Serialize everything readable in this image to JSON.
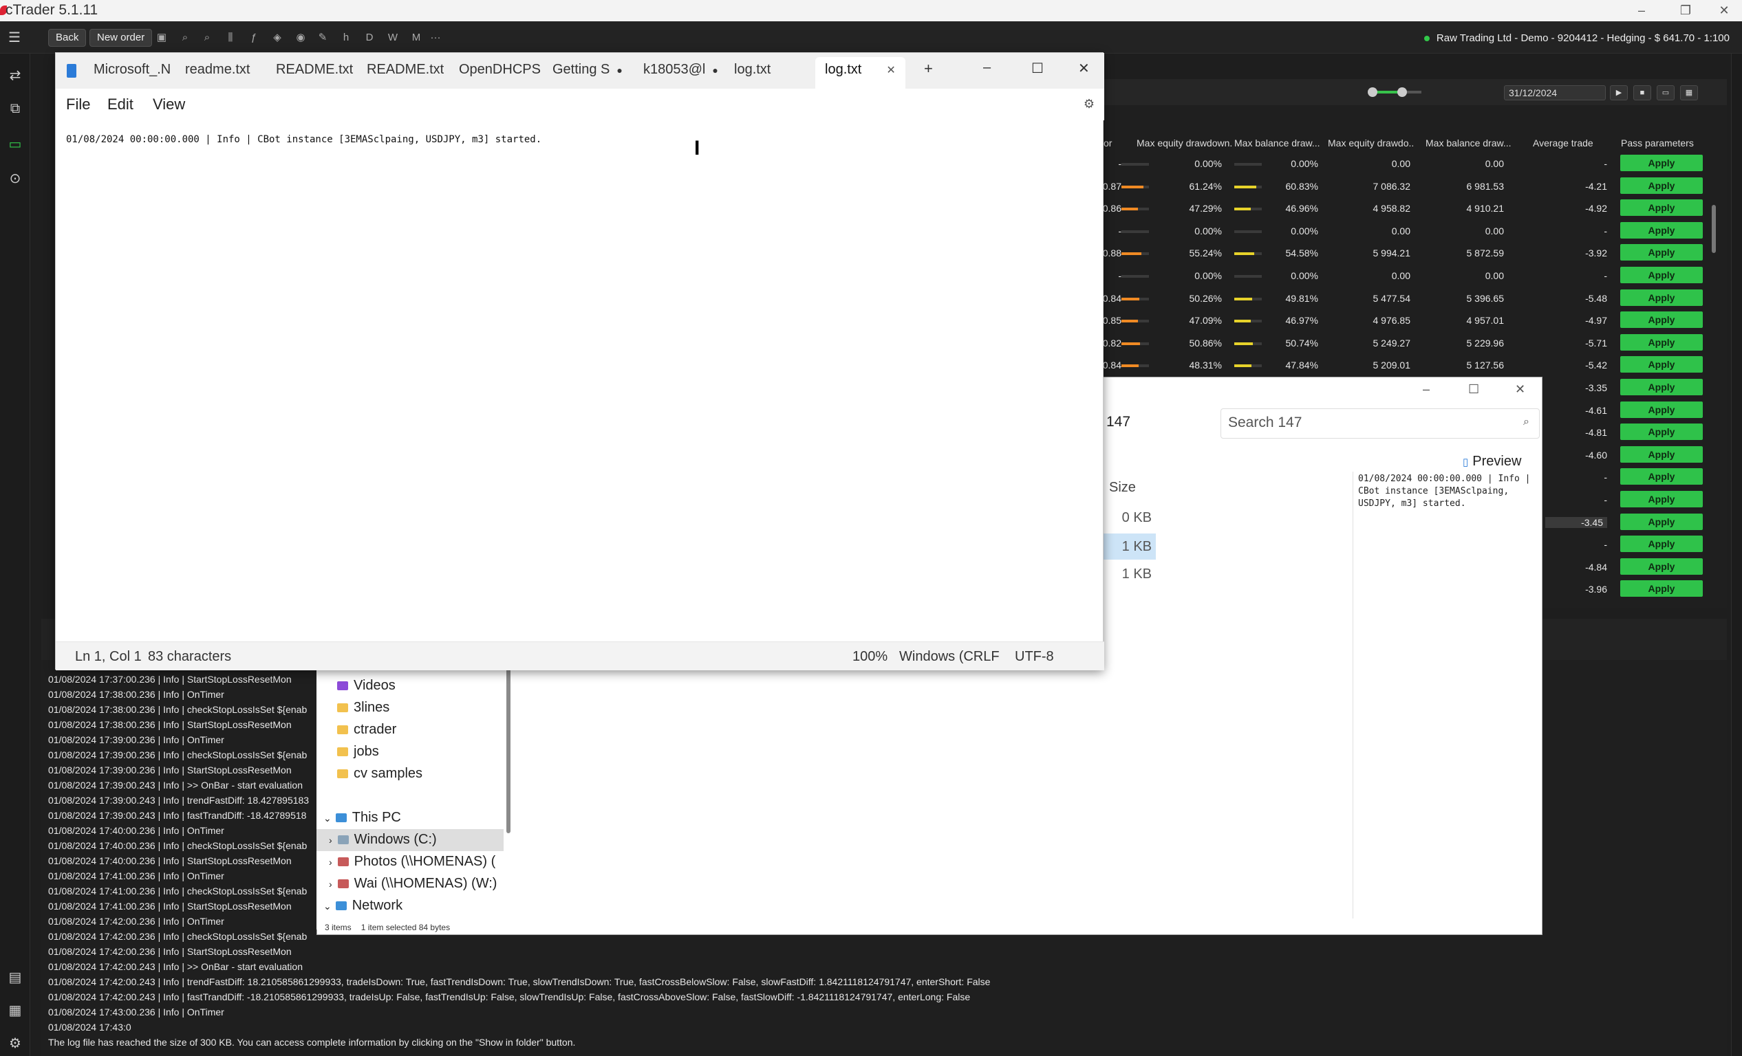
{
  "app": {
    "title": "cTrader 5.1.11"
  },
  "toolbar": {
    "back_label": "Back",
    "new_order_label": "New order",
    "timeframes": [
      "h",
      "D",
      "W",
      "M"
    ],
    "more": "···"
  },
  "account": {
    "label": "Raw Trading Ltd - Demo - 9204412 - Hedging - $ 641.70 - 1:100"
  },
  "optimisation": {
    "end_date": "31/12/2024",
    "columns": [
      "or",
      "Max equity drawdown...",
      "Max balance draw...",
      "Max equity drawdo...",
      "Max balance draw...",
      "Average trade",
      "Pass parameters"
    ],
    "apply_label": "Apply",
    "rows": [
      {
        "c0": "-",
        "eq_pct": "0.00%",
        "bal_pct": "0.00%",
        "eq_abs": "0.00",
        "bal_abs": "0.00",
        "avg": "-",
        "eq_fill": 0.0,
        "bal_fill": 0.0
      },
      {
        "c0": "0.87",
        "eq_pct": "61.24%",
        "bal_pct": "60.83%",
        "eq_abs": "7 086.32",
        "bal_abs": "6 981.53",
        "avg": "-4.21",
        "eq_fill": 0.61,
        "bal_fill": 0.61
      },
      {
        "c0": "0.86",
        "eq_pct": "47.29%",
        "bal_pct": "46.96%",
        "eq_abs": "4 958.82",
        "bal_abs": "4 910.21",
        "avg": "-4.92",
        "eq_fill": 0.47,
        "bal_fill": 0.47
      },
      {
        "c0": "-",
        "eq_pct": "0.00%",
        "bal_pct": "0.00%",
        "eq_abs": "0.00",
        "bal_abs": "0.00",
        "avg": "-",
        "eq_fill": 0.0,
        "bal_fill": 0.0
      },
      {
        "c0": "0.88",
        "eq_pct": "55.24%",
        "bal_pct": "54.58%",
        "eq_abs": "5 994.21",
        "bal_abs": "5 872.59",
        "avg": "-3.92",
        "eq_fill": 0.55,
        "bal_fill": 0.55
      },
      {
        "c0": "-",
        "eq_pct": "0.00%",
        "bal_pct": "0.00%",
        "eq_abs": "0.00",
        "bal_abs": "0.00",
        "avg": "-",
        "eq_fill": 0.0,
        "bal_fill": 0.0
      },
      {
        "c0": "0.84",
        "eq_pct": "50.26%",
        "bal_pct": "49.81%",
        "eq_abs": "5 477.54",
        "bal_abs": "5 396.65",
        "avg": "-5.48",
        "eq_fill": 0.5,
        "bal_fill": 0.5
      },
      {
        "c0": "0.85",
        "eq_pct": "47.09%",
        "bal_pct": "46.97%",
        "eq_abs": "4 976.85",
        "bal_abs": "4 957.01",
        "avg": "-4.97",
        "eq_fill": 0.47,
        "bal_fill": 0.47
      },
      {
        "c0": "0.82",
        "eq_pct": "50.86%",
        "bal_pct": "50.74%",
        "eq_abs": "5 249.27",
        "bal_abs": "5 229.96",
        "avg": "-5.71",
        "eq_fill": 0.51,
        "bal_fill": 0.51
      },
      {
        "c0": "0.84",
        "eq_pct": "48.31%",
        "bal_pct": "47.84%",
        "eq_abs": "5 209.01",
        "bal_abs": "5 127.56",
        "avg": "-5.42",
        "eq_fill": 0.48,
        "bal_fill": 0.48
      }
    ],
    "lower_avg": [
      "-3.35",
      "-4.61",
      "-4.81",
      "-4.60",
      "-",
      "-",
      "-3.45",
      "-",
      "-4.84",
      "-3.96"
    ]
  },
  "log": {
    "lines": [
      "01/08/2024 17:37:00.236 | Info | StartStopLossResetMon",
      "01/08/2024 17:38:00.236 | Info | OnTimer",
      "01/08/2024 17:38:00.236 | Info | checkStopLossIsSet ${enab",
      "01/08/2024 17:38:00.236 | Info | StartStopLossResetMon",
      "01/08/2024 17:39:00.236 | Info | OnTimer",
      "01/08/2024 17:39:00.236 | Info | checkStopLossIsSet ${enab",
      "01/08/2024 17:39:00.236 | Info | StartStopLossResetMon",
      "01/08/2024 17:39:00.243 | Info | >> OnBar - start evaluation",
      "01/08/2024 17:39:00.243 | Info | trendFastDiff: 18.427895183",
      "01/08/2024 17:39:00.243 | Info | fastTrandDiff: -18.42789518",
      "01/08/2024 17:40:00.236 | Info | OnTimer",
      "01/08/2024 17:40:00.236 | Info | checkStopLossIsSet ${enab",
      "01/08/2024 17:40:00.236 | Info | StartStopLossResetMon",
      "01/08/2024 17:41:00.236 | Info | OnTimer",
      "01/08/2024 17:41:00.236 | Info | checkStopLossIsSet ${enab",
      "01/08/2024 17:41:00.236 | Info | StartStopLossResetMon",
      "01/08/2024 17:42:00.236 | Info | OnTimer",
      "01/08/2024 17:42:00.236 | Info | checkStopLossIsSet ${enab",
      "01/08/2024 17:42:00.236 | Info | StartStopLossResetMon",
      "01/08/2024 17:42:00.243 | Info | >> OnBar - start evaluation",
      "01/08/2024 17:42:00.243 | Info | trendFastDiff: 18.210585861299933, tradeIsDown: True, fastTrendIsDown: True, slowTrendIsDown: True, fastCrossBelowSlow: False, slowFastDiff: 1.8421118124791747, enterShort: False",
      "01/08/2024 17:42:00.243 | Info | fastTrandDiff: -18.210585861299933, tradeIsUp: False, fastTrendIsUp: False, slowTrendIsUp: False, fastCrossAboveSlow: False, fastSlowDiff: -1.8421118124791747, enterLong: False",
      "01/08/2024 17:43:00.236 | Info | OnTimer",
      "01/08/2024 17:43:0",
      "The log file has reached the size of 300 KB. You can access complete information by clicking on the \"Show in folder\" button."
    ]
  },
  "explorer": {
    "address": "147",
    "search_placeholder": "Search 147",
    "preview_label": "Preview",
    "size_header": "Size",
    "sizes": [
      "0 KB",
      "1 KB",
      "1 KB"
    ],
    "preview_text": "01/08/2024 00:00:00.000 | Info |\nCBot instance [3EMASclpaing,\nUSDJPY, m3] started.",
    "nav": {
      "quick": [
        "Videos",
        "3lines",
        "ctrader",
        "jobs",
        "cv samples"
      ],
      "this_pc": "This PC",
      "drives": [
        "Windows (C:)",
        "Photos (\\\\HOMENAS) (",
        "Wai (\\\\HOMENAS) (W:)"
      ],
      "network": "Network"
    },
    "status": {
      "items": "3 items",
      "selected": "1 item selected  84 bytes"
    }
  },
  "notepad": {
    "tabs": [
      "Microsoft_.N",
      "readme.txt",
      "README.txt",
      "README.txt",
      "OpenDHCPS",
      "Getting S",
      "k18053@l",
      "log.txt"
    ],
    "active_tab": "log.txt",
    "menu": [
      "File",
      "Edit",
      "View"
    ],
    "content": "01/08/2024 00:00:00.000 | Info | CBot instance [3EMASclpaing, USDJPY, m3] started.",
    "status": {
      "position": "Ln 1, Col 1",
      "chars": "83 characters",
      "zoom": "100%",
      "line_ending": "Windows (CRLF",
      "encoding": "UTF-8"
    }
  },
  "colors": {
    "apply": "#2fc24a",
    "accent_orange": "#f08a24",
    "accent_yellow": "#e6d22a"
  }
}
